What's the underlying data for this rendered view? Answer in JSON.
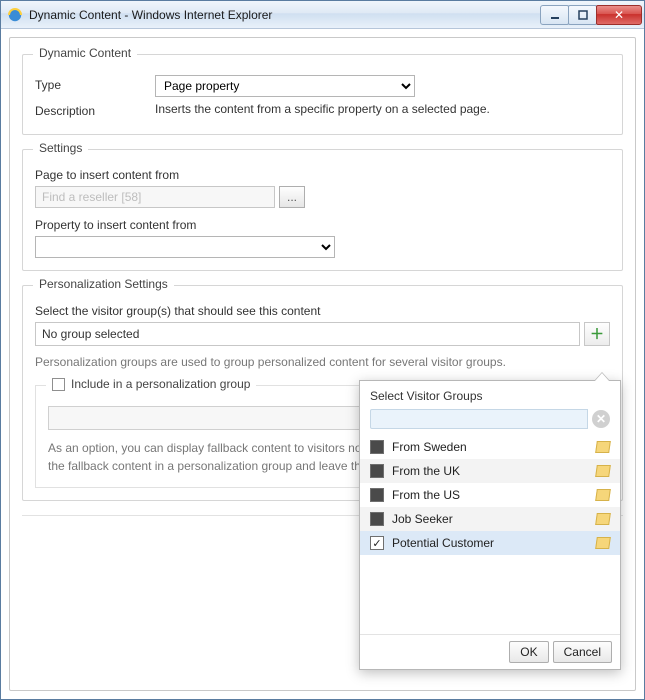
{
  "window": {
    "title": "Dynamic Content - Windows Internet Explorer"
  },
  "dynamic_content": {
    "legend": "Dynamic Content",
    "type_label": "Type",
    "type_value": "Page property",
    "description_label": "Description",
    "description_value": "Inserts the content from a specific property on a selected page."
  },
  "settings": {
    "legend": "Settings",
    "page_label": "Page to insert content from",
    "page_placeholder": "Find a reseller [58]",
    "browse_label": "...",
    "property_label": "Property to insert content from"
  },
  "personalization": {
    "legend": "Personalization Settings",
    "select_label": "Select the visitor group(s) that should see this content",
    "selected_group": "No group selected",
    "help_text": "Personalization groups are used to group personalized content for several visitor groups.",
    "include_legend": "Include in a personalization group",
    "option_text": "As an option, you can display fallback content to visitors not matching any visitor group. If so, include the fallback content in a personalization group and leave the visitor group empty."
  },
  "popup": {
    "title": "Select Visitor Groups",
    "groups": [
      {
        "name": "From Sweden",
        "checked": false
      },
      {
        "name": "From the UK",
        "checked": false
      },
      {
        "name": "From the US",
        "checked": false
      },
      {
        "name": "Job Seeker",
        "checked": false
      },
      {
        "name": "Potential Customer",
        "checked": true
      }
    ],
    "ok": "OK",
    "cancel": "Cancel"
  },
  "help_icon": "?"
}
